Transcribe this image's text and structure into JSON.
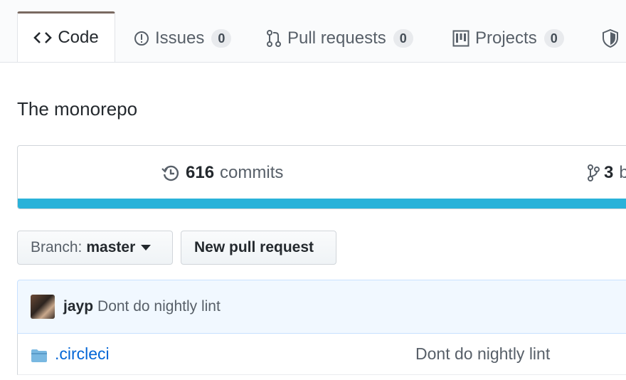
{
  "tabs": [
    {
      "label": "Code",
      "icon": "code-icon",
      "selected": true
    },
    {
      "label": "Issues",
      "icon": "issue-icon",
      "count": "0"
    },
    {
      "label": "Pull requests",
      "icon": "pull-request-icon",
      "count": "0"
    },
    {
      "label": "Projects",
      "icon": "project-icon",
      "count": "0"
    },
    {
      "icon": "shield-icon"
    }
  ],
  "description": "The monorepo",
  "summary": {
    "commits_count": "616",
    "commits_label": "commits",
    "branches_count": "3",
    "branches_label_partial": "b",
    "language_bar_color": "#2ab2d9"
  },
  "branch_button": {
    "label": "Branch:",
    "value": "master"
  },
  "new_pr_button": {
    "label": "New pull request"
  },
  "latest_commit": {
    "author": "jayp",
    "message": "Dont do nightly lint"
  },
  "files": [
    {
      "name": ".circleci",
      "type": "folder",
      "message": "Dont do nightly lint"
    }
  ],
  "colors": {
    "link": "#0366d6",
    "accent_bar": "#2ab2d9",
    "selected_tab_border": "#7a6a61"
  }
}
